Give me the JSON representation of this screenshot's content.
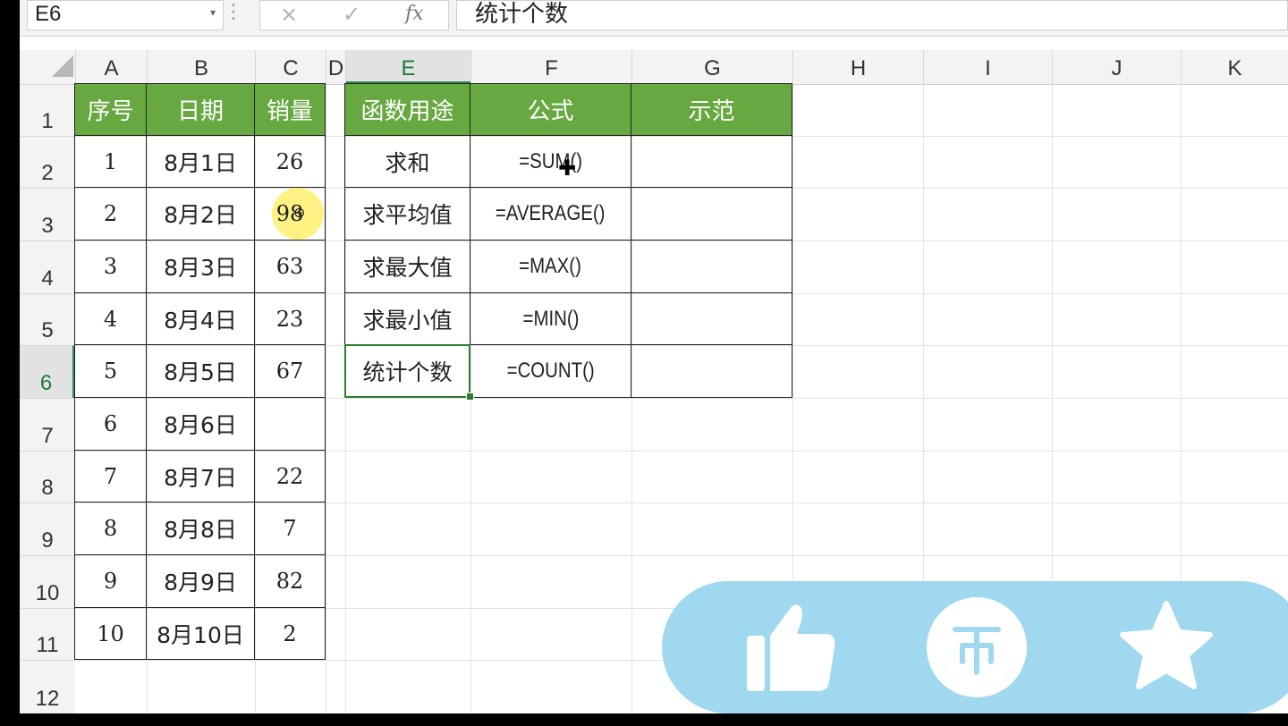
{
  "formula_bar": {
    "name_box": "E6",
    "cancel_icon": "×",
    "confirm_icon": "✓",
    "fx_label": "fx",
    "content": "统计个数"
  },
  "columns": [
    "A",
    "B",
    "C",
    "D",
    "E",
    "F",
    "G",
    "H",
    "I",
    "J",
    "K"
  ],
  "rows": [
    "1",
    "2",
    "3",
    "4",
    "5",
    "6",
    "7",
    "8",
    "9",
    "10",
    "11",
    "12"
  ],
  "selection": {
    "cell": "E6",
    "column": "E",
    "row": "6"
  },
  "sales_table": {
    "headers": [
      "序号",
      "日期",
      "销量"
    ],
    "rows": [
      [
        "1",
        "8月1日",
        "26"
      ],
      [
        "2",
        "8月2日",
        "98"
      ],
      [
        "3",
        "8月3日",
        "63"
      ],
      [
        "4",
        "8月4日",
        "23"
      ],
      [
        "5",
        "8月5日",
        "67"
      ],
      [
        "6",
        "8月6日",
        ""
      ],
      [
        "7",
        "8月7日",
        "22"
      ],
      [
        "8",
        "8月8日",
        "7"
      ],
      [
        "9",
        "8月9日",
        "82"
      ],
      [
        "10",
        "8月10日",
        "2"
      ]
    ]
  },
  "function_table": {
    "headers": [
      "函数用途",
      "公式",
      "示范"
    ],
    "rows": [
      [
        "求和",
        "=SUM()",
        ""
      ],
      [
        "求平均值",
        "=AVERAGE()",
        ""
      ],
      [
        "求最大值",
        "=MAX()",
        ""
      ],
      [
        "求最小值",
        "=MIN()",
        ""
      ],
      [
        "统计个数",
        "=COUNT()",
        ""
      ]
    ]
  },
  "colors": {
    "header_green": "#67a840",
    "selection_green": "#2e7d32",
    "overlay_blue": "#9fd8ef",
    "highlight_yellow": "#fff06e"
  },
  "overlay_icons": [
    "thumbs-up-icon",
    "coin-icon",
    "star-icon"
  ]
}
